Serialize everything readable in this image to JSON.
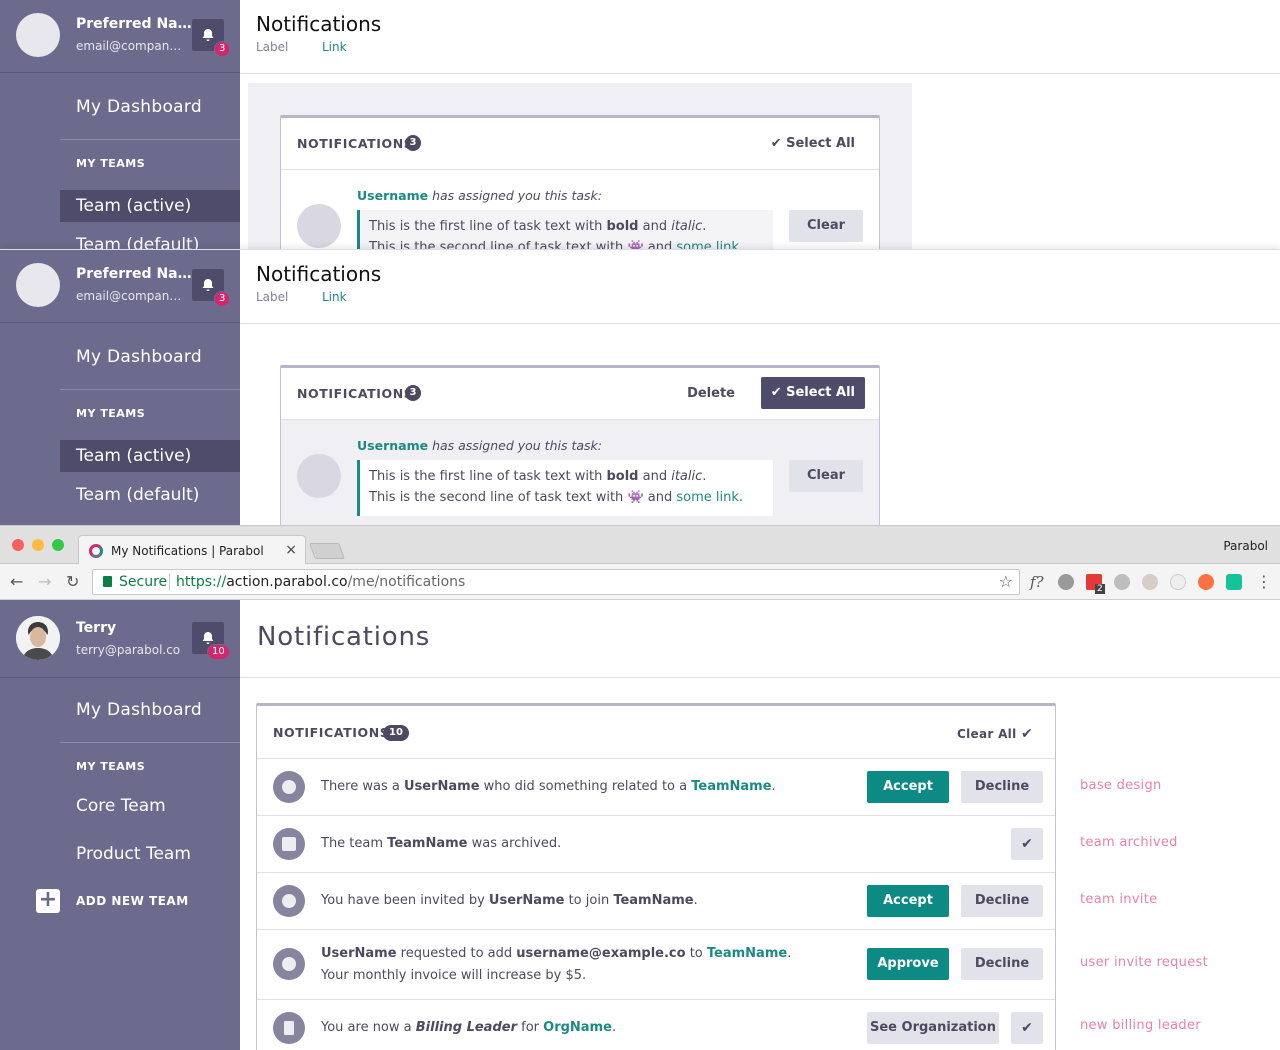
{
  "panel1": {
    "user": {
      "name": "Preferred Na…",
      "email": "email@compan…",
      "notif_count": "3"
    },
    "nav": {
      "dashboard": "My Dashboard",
      "my_teams": "MY TEAMS",
      "team_active": "Team (active)",
      "team_default": "Team (default)"
    },
    "header": {
      "title": "Notifications",
      "label": "Label",
      "link": "Link"
    },
    "card": {
      "title": "NOTIFICATIONS",
      "count": "3",
      "select_all": "Select All",
      "item": {
        "username": "Username",
        "assigned": "has assigned you this task:",
        "line1_a": "This is the first line of task text with ",
        "line1_bold": "bold",
        "line1_and": " and ",
        "line1_italic": "italic",
        "line2_a": "This is the second line of task text with ",
        "line2_and": " and ",
        "line2_link": "some link",
        "clear": "Clear"
      }
    }
  },
  "panel2": {
    "user": {
      "name": "Preferred Na…",
      "email": "email@compan…",
      "notif_count": "3"
    },
    "nav": {
      "dashboard": "My Dashboard",
      "my_teams": "MY TEAMS",
      "team_active": "Team (active)",
      "team_default": "Team (default)"
    },
    "header": {
      "title": "Notifications",
      "label": "Label",
      "link": "Link"
    },
    "card": {
      "title": "NOTIFICATIONS",
      "count": "3",
      "delete": "Delete",
      "select_all": "Select All",
      "item": {
        "username": "Username",
        "assigned": "has assigned you this task:",
        "line1_a": "This is the first line of task text with ",
        "line1_bold": "bold",
        "line1_and": " and ",
        "line1_italic": "italic",
        "line2_a": "This is the second line of task text with ",
        "line2_and": " and ",
        "line2_link": "some link",
        "clear": "Clear"
      }
    }
  },
  "browser": {
    "tab_title": "My Notifications | Parabol",
    "tab_close": "×",
    "profile": "Parabol",
    "secure": "Secure",
    "url_scheme": "https://",
    "url_host": "action.parabol.co",
    "url_path": "/me/notifications",
    "ext_badge": "2"
  },
  "panel3": {
    "user": {
      "name": "Terry",
      "email": "terry@parabol.co",
      "notif_count": "10"
    },
    "nav": {
      "dashboard": "My Dashboard",
      "my_teams": "MY TEAMS",
      "team1": "Core Team",
      "team2": "Product Team",
      "add_team": "ADD NEW TEAM"
    },
    "title": "Notifications",
    "card": {
      "title": "NOTIFICATIONS",
      "count": "10",
      "clear_all": "Clear All",
      "rows": [
        {
          "pre": "There was a ",
          "b1": "UserName",
          "mid": " who did something related to a ",
          "link": "TeamName",
          "post": ".",
          "btn1": "Accept",
          "btn2": "Decline",
          "annotation": "base design"
        },
        {
          "pre": "The team ",
          "b1": "TeamName",
          "post": " was archived.",
          "annotation": "team archived"
        },
        {
          "pre": "You have been invited by ",
          "b1": "UserName",
          "mid": " to join ",
          "b2": "TeamName",
          "post": ".",
          "btn1": "Accept",
          "btn2": "Decline",
          "annotation": "team invite"
        },
        {
          "b1": "UserName",
          "mid": " requested to add ",
          "b2": "username@example.co",
          "mid2": " to ",
          "link": "TeamName",
          "post": ".",
          "line2": "Your monthly invoice will increase by $5.",
          "btn1": "Approve",
          "btn2": "Decline",
          "annotation": "user invite request"
        },
        {
          "pre": "You are now a ",
          "bi": "Billing Leader",
          "mid": " for ",
          "link": "OrgName",
          "post": ".",
          "btn1": "See Organization",
          "annotation": "new billing leader"
        }
      ]
    }
  },
  "colors": {
    "sidebar": "#6d6b8d",
    "sidebar_dark": "#4e4c6a",
    "teal": "#1b8a85",
    "badge": "#d4266c",
    "annotation": "#e981ad"
  },
  "icons": [
    "bell-icon",
    "check-icon",
    "plus-icon",
    "user-circle-icon",
    "archive-icon",
    "group-icon",
    "building-icon",
    "lock-icon",
    "star-icon",
    "back-arrow-icon",
    "forward-arrow-icon",
    "reload-icon"
  ]
}
